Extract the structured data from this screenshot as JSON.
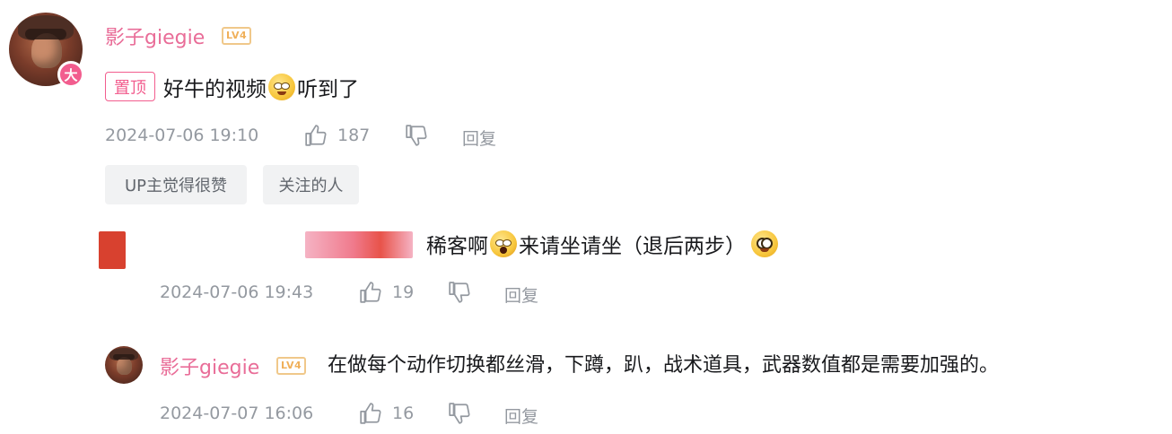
{
  "top_comment": {
    "username": "影子giegie",
    "level": "LV4",
    "avatar_badge": "大",
    "pin_label": "置顶",
    "text_before_emoji": "好牛的视频",
    "text_after_emoji": "听到了",
    "timestamp": "2024-07-06 19:10",
    "like_count": "187",
    "reply_label": "回复",
    "tags": [
      "UP主觉得很赞",
      "关注的人"
    ]
  },
  "reply_1": {
    "text_before_emoji": "稀客啊",
    "text_middle": "来请坐请坐（退后两步）",
    "timestamp": "2024-07-06 19:43",
    "like_count": "19",
    "reply_label": "回复"
  },
  "reply_2": {
    "username": "影子giegie",
    "level": "LV4",
    "text": "在做每个动作切换都丝滑，下蹲，趴，战术道具，武器数值都是需要加强的。",
    "timestamp": "2024-07-07 16:06",
    "like_count": "16",
    "reply_label": "回复"
  },
  "colors": {
    "username": "#e96d98",
    "pin": "#f25d8e",
    "meta": "#9499a0",
    "level_badge": "#f0b05a"
  },
  "icons": {
    "like": "thumbs-up-icon",
    "dislike": "thumbs-down-icon"
  }
}
